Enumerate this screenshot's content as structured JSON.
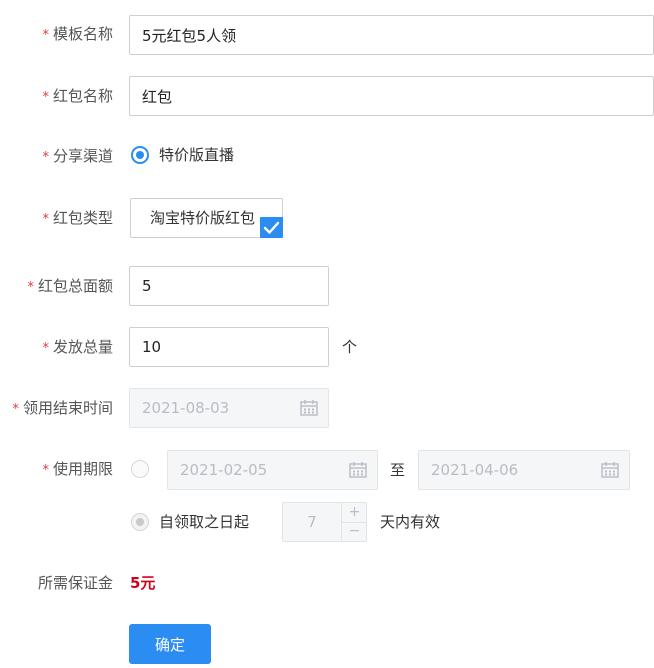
{
  "form": {
    "template_name": {
      "label": "模板名称",
      "value": "5元红包5人领"
    },
    "redpack_name": {
      "label": "红包名称",
      "value": "红包"
    },
    "share_channel": {
      "label": "分享渠道",
      "option": "特价版直播"
    },
    "redpack_type": {
      "label": "红包类型",
      "option": "淘宝特价版红包"
    },
    "total_amount": {
      "label": "红包总面额",
      "value": "5"
    },
    "total_count": {
      "label": "发放总量",
      "value": "10",
      "unit": "个"
    },
    "claim_end_time": {
      "label": "领用结束时间",
      "value": "2021-08-03"
    },
    "validity": {
      "label": "使用期限",
      "start_date": "2021-02-05",
      "separator": "至",
      "end_date": "2021-04-06",
      "relative_option": "自领取之日起",
      "days_value": "7",
      "plus": "+",
      "minus": "−",
      "days_suffix": "天内有效"
    },
    "deposit": {
      "label": "所需保证金",
      "value": "5元"
    },
    "required_mark": "*",
    "submit_label": "确定"
  },
  "colors": {
    "accent": "#2b8cf2",
    "required": "#e5383b",
    "deposit": "#d0021b"
  }
}
